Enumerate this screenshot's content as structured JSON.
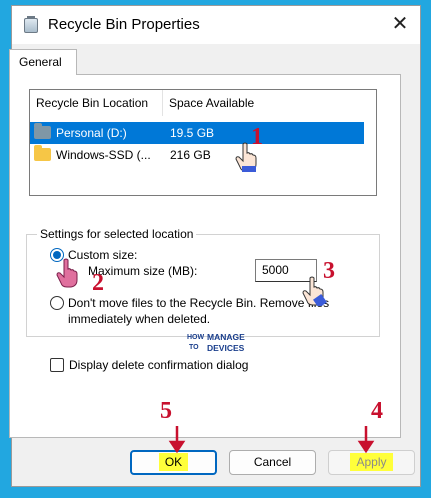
{
  "window": {
    "title": "Recycle Bin Properties",
    "close_glyph": "✕"
  },
  "tabs": [
    {
      "label": "General"
    }
  ],
  "listview": {
    "columns": [
      "Recycle Bin Location",
      "Space Available"
    ],
    "rows": [
      {
        "location": "Personal (D:)",
        "space": "19.5 GB",
        "icon": "folder-gray-icon"
      },
      {
        "location": "Windows-SSD (...",
        "space": "216 GB",
        "icon": "folder-yellow-icon"
      }
    ]
  },
  "settings": {
    "legend": "Settings for selected location",
    "custom_size_label": "Custom size:",
    "max_size_label": "Maximum size (MB):",
    "max_size_value": "5000",
    "dont_move_label_line1": "Don't move files to the Recycle Bin. Remove files",
    "dont_move_label_line2": "immediately when deleted."
  },
  "confirm_checkbox_label": "Display delete confirmation dialog",
  "buttons": {
    "ok": "OK",
    "cancel": "Cancel",
    "apply": "Apply"
  },
  "watermark": {
    "line1": "HOW",
    "line2": "TO",
    "brand1": "MANAGE",
    "brand2": "DEVICES"
  },
  "annotations": [
    "1",
    "2",
    "3",
    "4",
    "5"
  ],
  "colors": {
    "background": "#22a7e0",
    "selection": "#0078d7",
    "highlight": "#ffff3a",
    "annotation": "#c8102e"
  }
}
